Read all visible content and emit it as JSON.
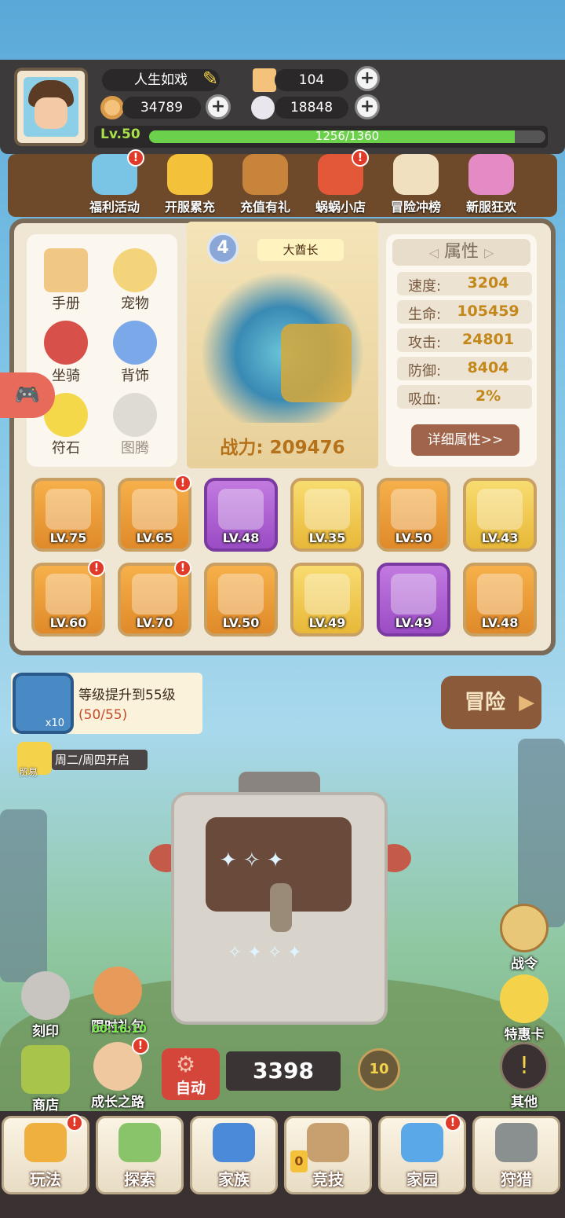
{
  "player": {
    "name": "人生如戏",
    "level": "Lv.50",
    "exp_text": "1256/1360",
    "exp_progress": 0.923
  },
  "resources": {
    "tickets": "104",
    "coins": "34789",
    "shells": "18848"
  },
  "activities": [
    {
      "label": "福利活动",
      "badge": "!"
    },
    {
      "label": "开服累充",
      "badge": ""
    },
    {
      "label": "充值有礼",
      "badge": ""
    },
    {
      "label": "蜗蜗小店",
      "badge": "!"
    },
    {
      "label": "冒险冲榜",
      "badge": ""
    },
    {
      "label": "新服狂欢",
      "badge": ""
    }
  ],
  "left_menu": [
    {
      "label": "手册"
    },
    {
      "label": "宠物"
    },
    {
      "label": "坐骑"
    },
    {
      "label": "背饰"
    },
    {
      "label": "符石"
    },
    {
      "label": "图腾"
    }
  ],
  "hero": {
    "rank": "4",
    "title": "大酋长",
    "power": "战力: 209476"
  },
  "attributes": {
    "title": "属性",
    "rows": [
      {
        "label": "速度:",
        "value": "3204"
      },
      {
        "label": "生命:",
        "value": "105459"
      },
      {
        "label": "攻击:",
        "value": "24801"
      },
      {
        "label": "防御:",
        "value": "8404"
      },
      {
        "label": "吸血:",
        "value": "2%"
      }
    ],
    "detail_button": "详细属性>>"
  },
  "equipment": [
    {
      "level": "LV.75",
      "rarity": "orange",
      "alert": false
    },
    {
      "level": "LV.65",
      "rarity": "orange",
      "alert": true
    },
    {
      "level": "LV.48",
      "rarity": "purple",
      "alert": false
    },
    {
      "level": "LV.35",
      "rarity": "gold",
      "alert": false
    },
    {
      "level": "LV.50",
      "rarity": "orange",
      "alert": false
    },
    {
      "level": "LV.43",
      "rarity": "gold",
      "alert": false
    },
    {
      "level": "LV.60",
      "rarity": "orange",
      "alert": true
    },
    {
      "level": "LV.70",
      "rarity": "orange",
      "alert": true
    },
    {
      "level": "LV.50",
      "rarity": "orange",
      "alert": false
    },
    {
      "level": "LV.49",
      "rarity": "gold",
      "alert": false
    },
    {
      "level": "LV.49",
      "rarity": "purple",
      "alert": false
    },
    {
      "level": "LV.48",
      "rarity": "orange",
      "alert": false
    }
  ],
  "quest": {
    "reward_count": "x10",
    "text": "等级提升到55级",
    "progress": "(50/55)"
  },
  "adventure_button": "冒险",
  "trade": {
    "label": "贸易",
    "info": "周二/周四开启"
  },
  "side_left": [
    {
      "label": "刻印"
    },
    {
      "label": "限时礼包",
      "timer": "00:16:10"
    },
    {
      "label": "商店"
    },
    {
      "label": "成长之路",
      "badge": "!"
    }
  ],
  "side_right": [
    {
      "label": "战令"
    },
    {
      "label": "特惠卡"
    },
    {
      "label": "其他"
    }
  ],
  "auto_button": "自动",
  "currency_count": "3398",
  "multiplier": "10",
  "bottom_nav": [
    {
      "label": "玩法",
      "badge": "!"
    },
    {
      "label": "探索",
      "badge": ""
    },
    {
      "label": "家族",
      "badge": ""
    },
    {
      "label": "竞技",
      "badge": "0"
    },
    {
      "label": "家园",
      "badge": "!"
    },
    {
      "label": "狩猎",
      "badge": ""
    }
  ],
  "colors": {
    "header": "#3c3a3a",
    "panel": "#efe6d4",
    "accent": "#c4881a",
    "badge": "#e03a2a"
  }
}
